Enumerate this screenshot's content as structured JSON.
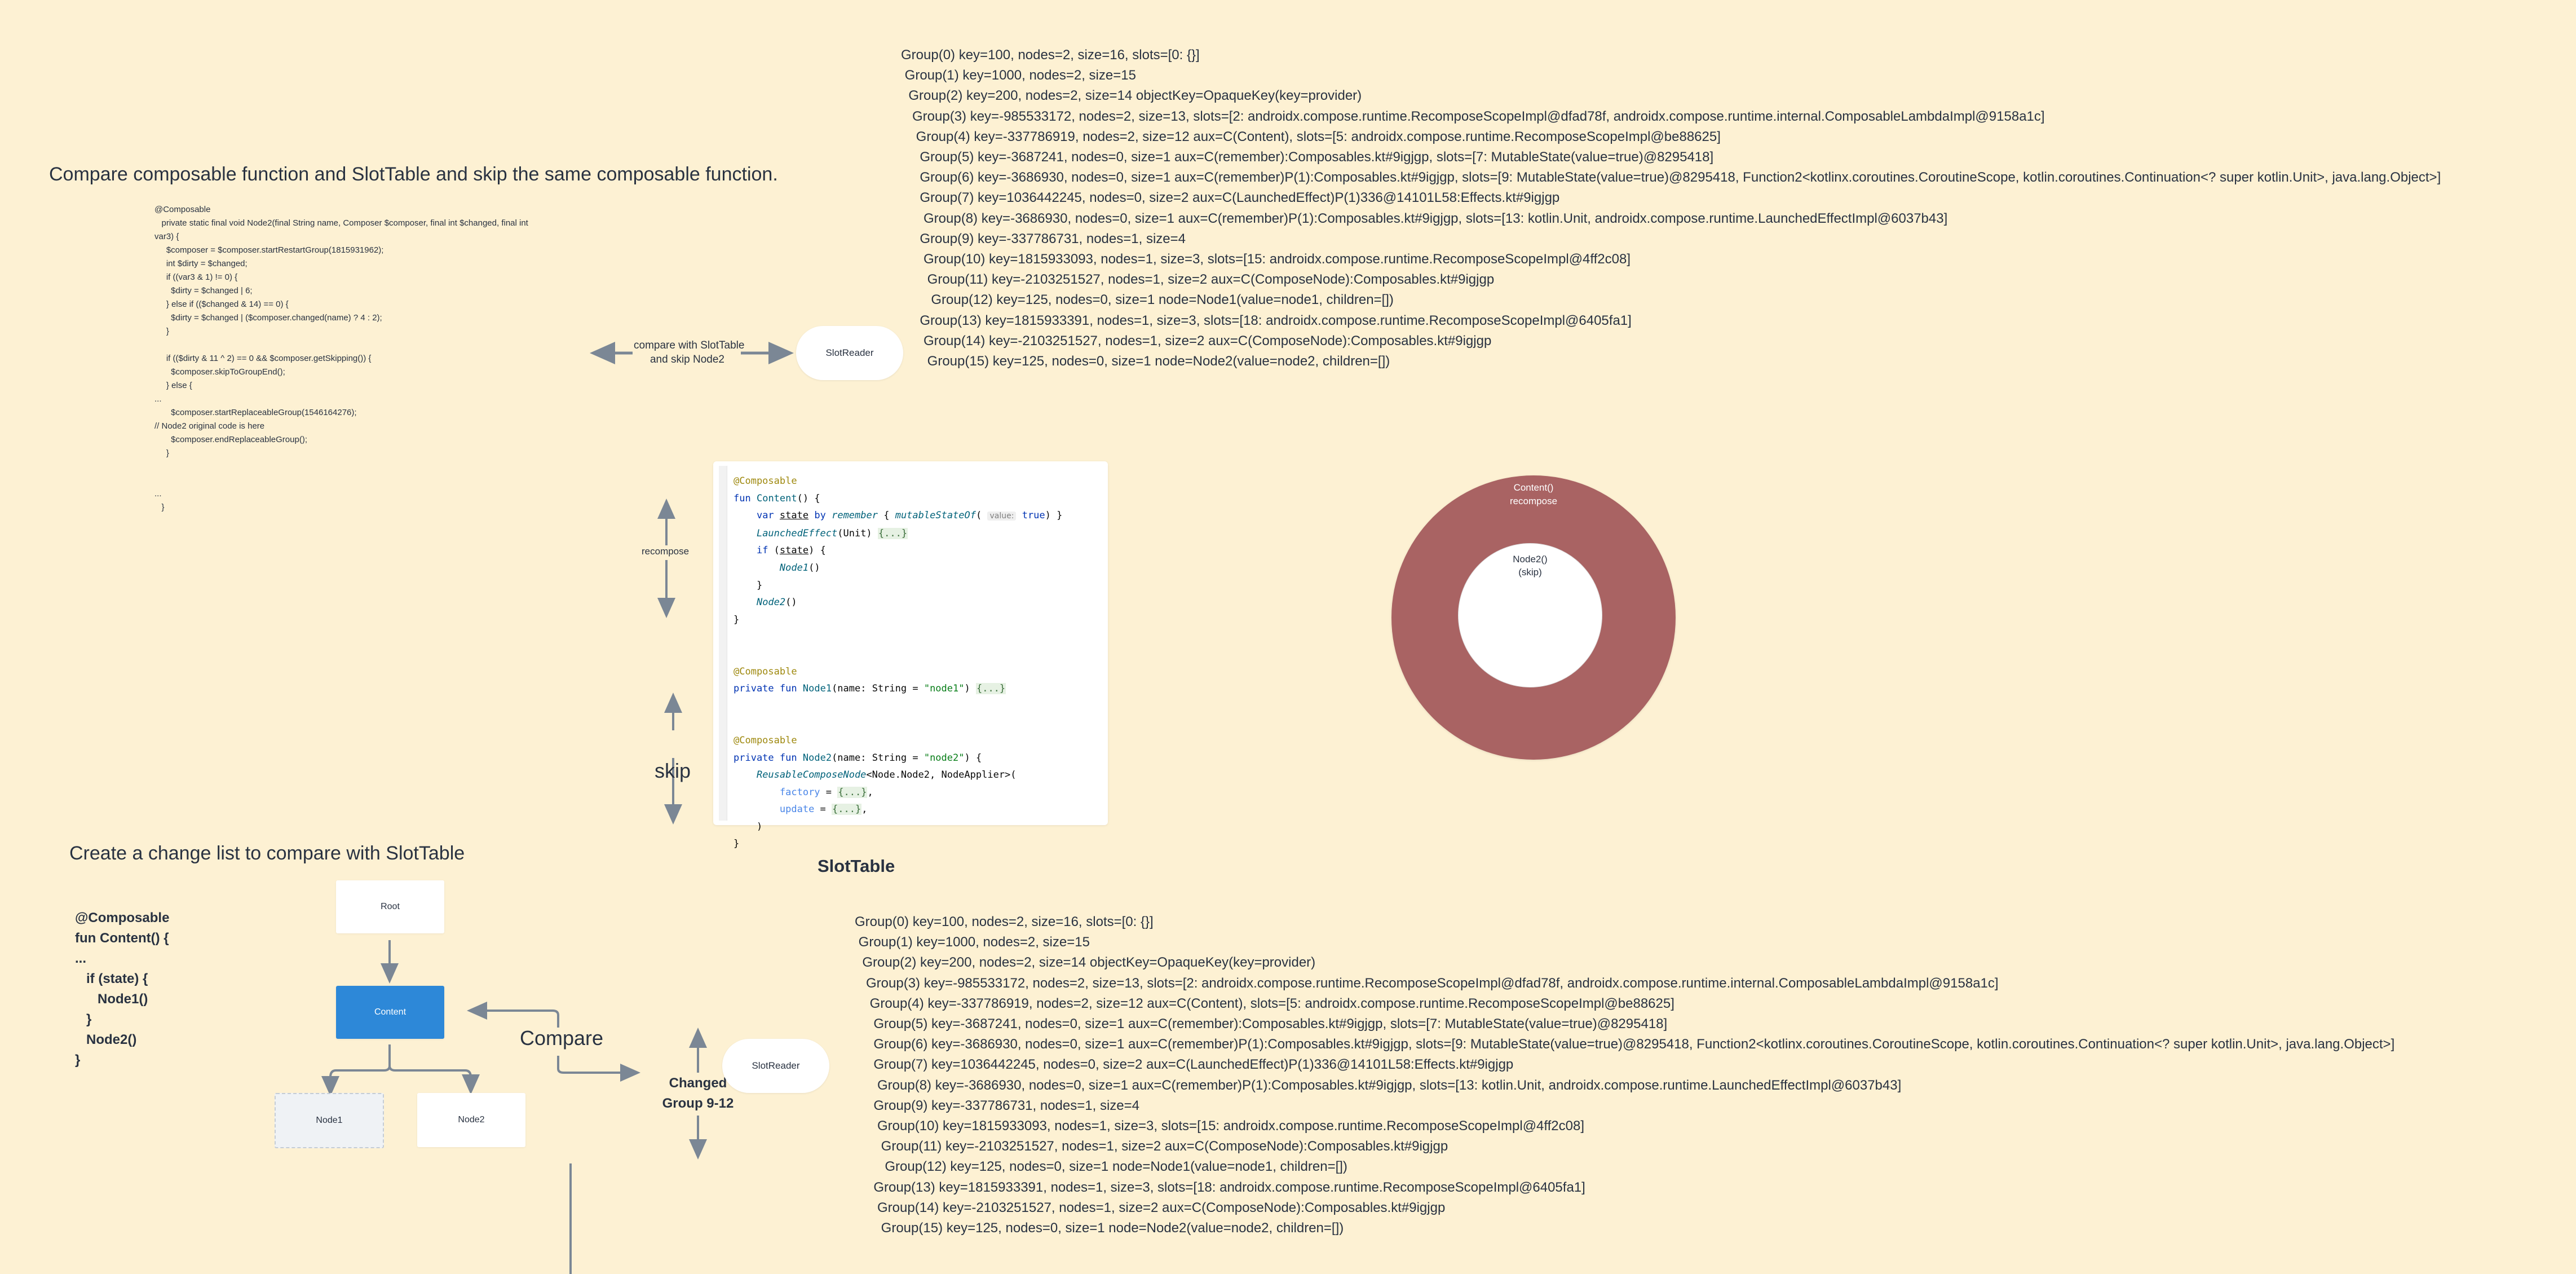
{
  "top_section": {
    "title": "Compare composable function and SlotTable and skip the same composable function.",
    "decompiled_code": "@Composable\n   private static final void Node2(final String name, Composer $composer, final int $changed, final int\nvar3) {\n     $composer = $composer.startRestartGroup(1815931962);\n     int $dirty = $changed;\n     if ((var3 & 1) != 0) {\n       $dirty = $changed | 6;\n     } else if (($changed & 14) == 0) {\n       $dirty = $changed | ($composer.changed(name) ? 4 : 2);\n     }\n\n     if (($dirty & 11 ^ 2) == 0 && $composer.getSkipping()) {\n       $composer.skipToGroupEnd();\n     } else {\n...\n       $composer.startReplaceableGroup(1546164276);\n// Node2 original code is here\n       $composer.endReplaceableGroup();\n     }\n\n\n...\n   }",
    "compare_label_line1": "compare with SlotTable",
    "compare_label_line2": "and skip Node2",
    "slot_reader": "SlotReader",
    "slot_table_lines": [
      "Group(0) key=100, nodes=2, size=16, slots=[0: {}]",
      " Group(1) key=1000, nodes=2, size=15",
      "  Group(2) key=200, nodes=2, size=14 objectKey=OpaqueKey(key=provider)",
      "   Group(3) key=-985533172, nodes=2, size=13, slots=[2: androidx.compose.runtime.RecomposeScopeImpl@dfad78f, androidx.compose.runtime.internal.ComposableLambdaImpl@9158a1c]",
      "    Group(4) key=-337786919, nodes=2, size=12 aux=C(Content), slots=[5: androidx.compose.runtime.RecomposeScopeImpl@be88625]",
      "     Group(5) key=-3687241, nodes=0, size=1 aux=C(remember):Composables.kt#9igjgp, slots=[7: MutableState(value=true)@8295418]",
      "     Group(6) key=-3686930, nodes=0, size=1 aux=C(remember)P(1):Composables.kt#9igjgp, slots=[9: MutableState(value=true)@8295418, Function2<kotlinx.coroutines.CoroutineScope, kotlin.coroutines.Continuation<? super kotlin.Unit>, java.lang.Object>]",
      "     Group(7) key=1036442245, nodes=0, size=2 aux=C(LaunchedEffect)P(1)336@14101L58:Effects.kt#9igjgp",
      "      Group(8) key=-3686930, nodes=0, size=1 aux=C(remember)P(1):Composables.kt#9igjgp, slots=[13: kotlin.Unit, androidx.compose.runtime.LaunchedEffectImpl@6037b43]",
      "     Group(9) key=-337786731, nodes=1, size=4",
      "      Group(10) key=1815933093, nodes=1, size=3, slots=[15: androidx.compose.runtime.RecomposeScopeImpl@4ff2c08]",
      "       Group(11) key=-2103251527, nodes=1, size=2 aux=C(ComposeNode):Composables.kt#9igjgp",
      "        Group(12) key=125, nodes=0, size=1 node=Node1(value=node1, children=[])",
      "     Group(13) key=1815933391, nodes=1, size=3, slots=[18: androidx.compose.runtime.RecomposeScopeImpl@6405fa1]",
      "      Group(14) key=-2103251527, nodes=1, size=2 aux=C(ComposeNode):Composables.kt#9igjgp",
      "       Group(15) key=125, nodes=0, size=1 node=Node2(value=node2, children=[])"
    ]
  },
  "middle_section": {
    "recompose_label": "recompose",
    "skip_label": "skip",
    "ide_code": {
      "annotation": "@Composable",
      "fun_kw": "fun",
      "content_name": "Content",
      "var_kw": "var",
      "state": "state",
      "by_kw": "by",
      "remember": "remember",
      "mutable_state_of": "mutableStateOf",
      "value_hint": "value:",
      "true_kw": "true",
      "launched_effect": "LaunchedEffect",
      "unit_arg": "(Unit)",
      "fold": "{...}",
      "if_kw": "if",
      "node1_call": "Node1",
      "node2_call": "Node2",
      "private_kw": "private",
      "node1_name": "Node1",
      "node2_name": "Node2",
      "name_param": "(name: String = ",
      "node1_str": "\"node1\"",
      "node2_str": "\"node2\"",
      "reusable": "ReusableComposeNode",
      "reusable_generic": "<Node.Node2, NodeApplier>(",
      "factory": "factory",
      "update": "update"
    },
    "donut": {
      "outer_line1": "Content()",
      "outer_line2": "recompose",
      "inner_line1": "Node2()",
      "inner_line2": "(skip)",
      "outer_color": "#a96363",
      "inner_color": "#ffffff"
    }
  },
  "bottom_section": {
    "title": "Create a change list to compare with SlotTable",
    "source_code": "@Composable\nfun Content() {\n...\n   if (state) {\n      Node1()\n   }\n   Node2()\n}",
    "tree": {
      "root": "Root",
      "content": "Content",
      "node1": "Node1",
      "node2": "Node2",
      "content_color": "#2d88d8"
    },
    "compare_label": "Compare",
    "changed_line1": "Changed",
    "changed_line2": "Group 9-12",
    "slot_reader": "SlotReader",
    "slot_table_title": "SlotTable"
  }
}
